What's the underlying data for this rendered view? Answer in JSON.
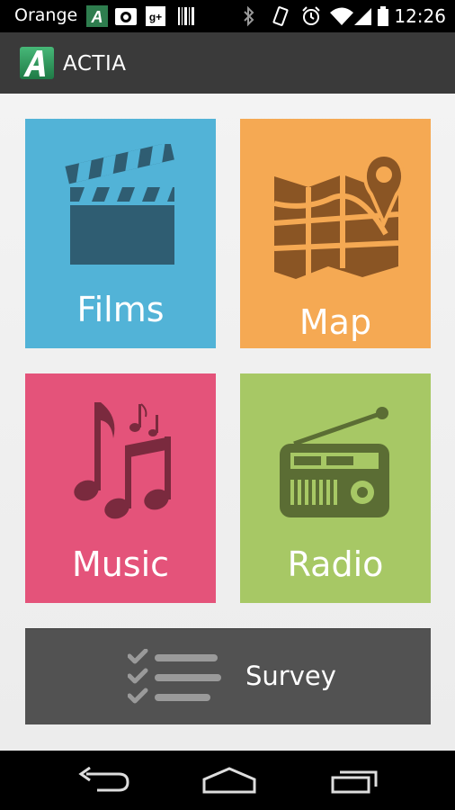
{
  "status_bar": {
    "carrier": "Orange",
    "time": "12:26",
    "left_icons": [
      "actia-notification-icon",
      "camera-notification-icon",
      "google-plus-notification-icon",
      "barcode-notification-icon"
    ],
    "right_icons": [
      "bluetooth-icon",
      "vibrate-icon",
      "alarm-icon",
      "wifi-icon",
      "signal-icon",
      "battery-icon"
    ]
  },
  "action_bar": {
    "title": "ACTIA",
    "logo_icon": "actia-logo-icon"
  },
  "tiles": [
    {
      "label": "Films",
      "icon": "clapperboard-icon",
      "color": "#52b3d7"
    },
    {
      "label": "Map",
      "icon": "map-pin-icon",
      "color": "#f5a953"
    },
    {
      "label": "Music",
      "icon": "music-notes-icon",
      "color": "#e4537a"
    },
    {
      "label": "Radio",
      "icon": "radio-icon",
      "color": "#a7c865"
    }
  ],
  "survey": {
    "label": "Survey",
    "icon": "checklist-icon",
    "color": "#525252"
  },
  "nav_bar": {
    "buttons": [
      "back-icon",
      "home-icon",
      "recent-apps-icon"
    ]
  }
}
